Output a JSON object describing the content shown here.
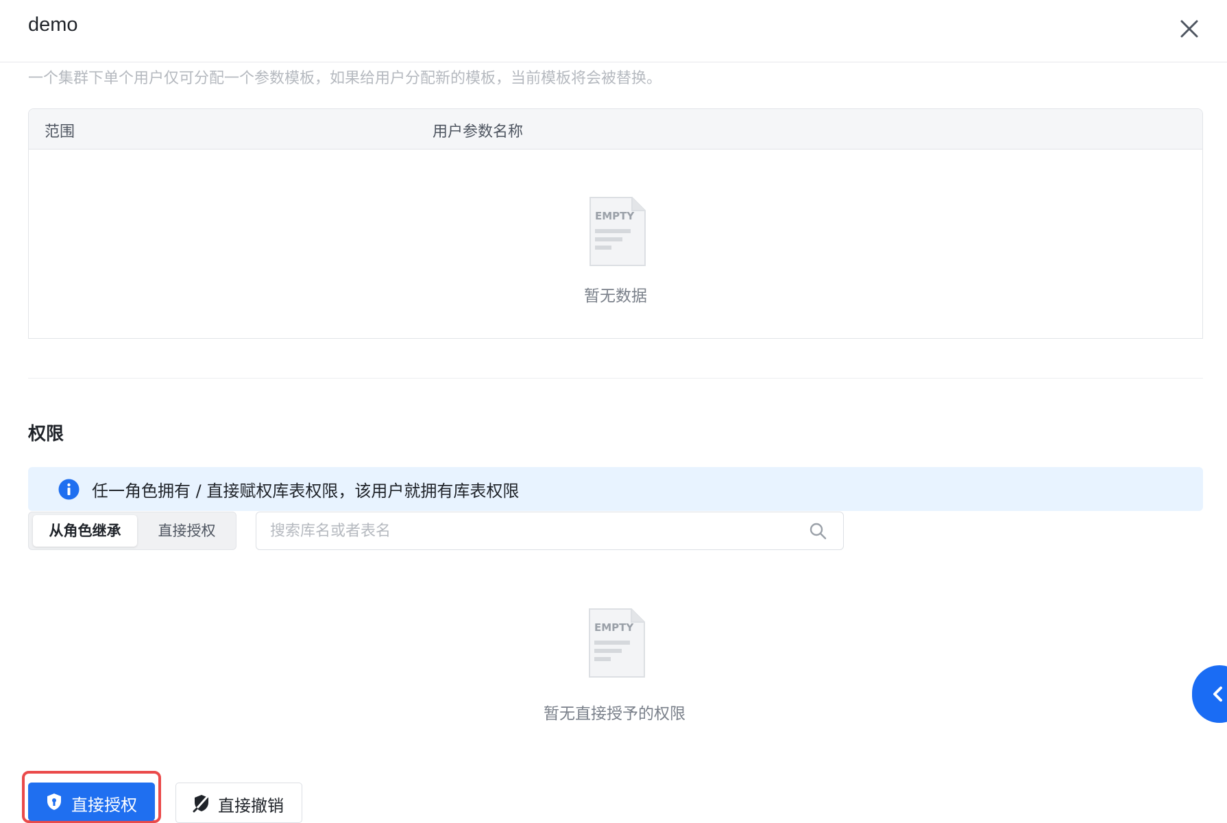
{
  "header": {
    "title": "demo",
    "close_icon": "close-icon"
  },
  "params": {
    "description": "一个集群下单个用户仅可分配一个参数模板，如果给用户分配新的模板，当前模板将会被替换。",
    "columns": [
      "范围",
      "用户参数名称"
    ],
    "empty_icon_text": "EMPTY",
    "empty_text": "暂无数据"
  },
  "permissions": {
    "section_title": "权限",
    "alert_text": "任一角色拥有 / 直接赋权库表权限，该用户就拥有库表权限",
    "alert_icon": "info-icon",
    "tabs": [
      "从角色继承",
      "直接授权"
    ],
    "active_tab": "从角色继承",
    "search_placeholder": "搜索库名或者表名",
    "search_value": "",
    "empty_text": "暂无直接授予的权限"
  },
  "actions": {
    "grant_label": "直接授权",
    "revoke_label": "直接撤销"
  },
  "colors": {
    "primary": "#1f6ff0",
    "alert_bg": "#e8f3ff",
    "highlight": "#ea4a4a"
  }
}
